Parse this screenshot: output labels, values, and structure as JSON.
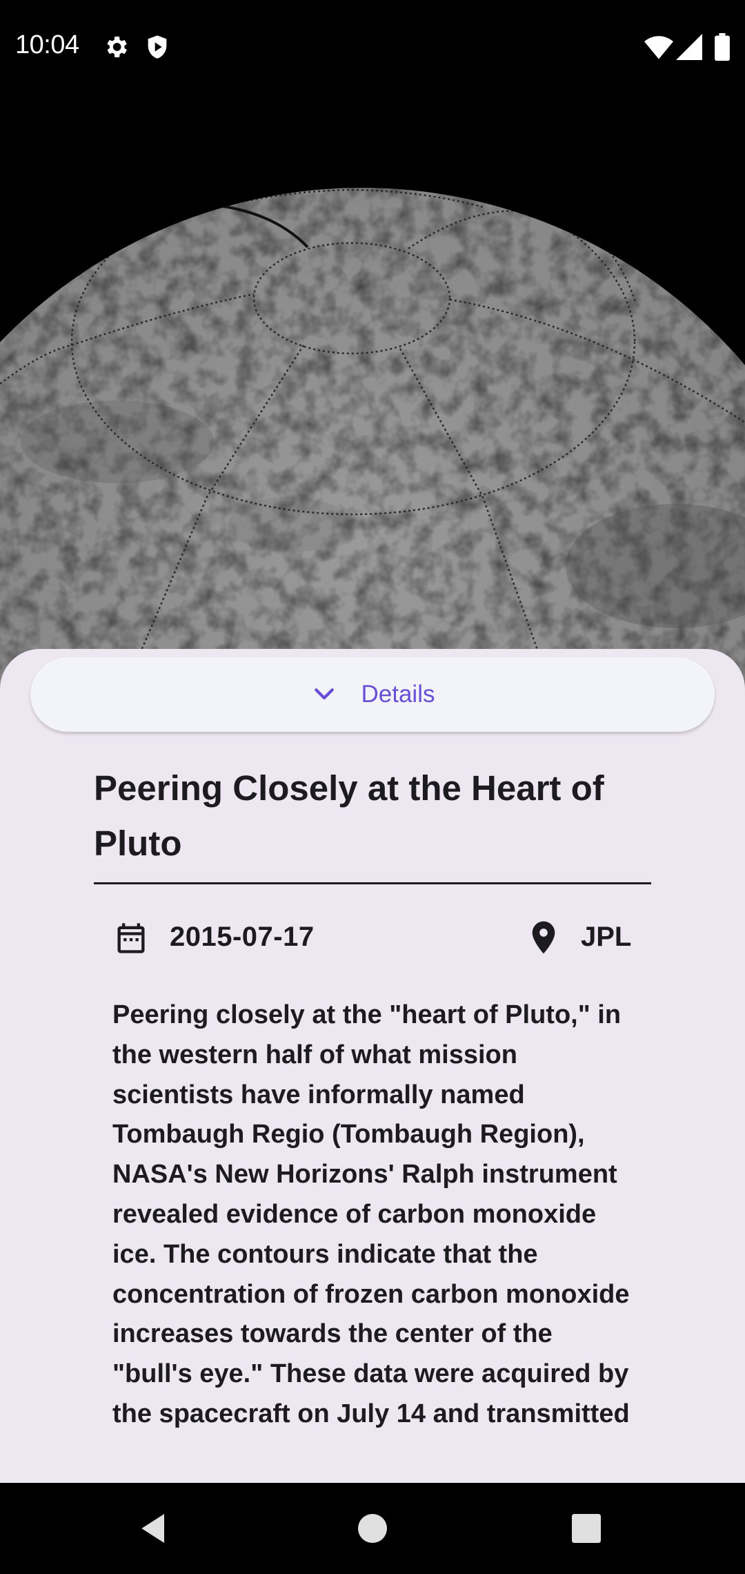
{
  "status_bar": {
    "time": "10:04",
    "icons": [
      "gear-icon",
      "shield-play-icon",
      "wifi-icon",
      "signal-icon",
      "battery-icon"
    ]
  },
  "hero": {
    "subject": "globe-image",
    "colors": {
      "surface": "#8c8c8c",
      "background": "#000000"
    }
  },
  "details_toggle": {
    "label": "Details",
    "icon": "chevron-down-icon",
    "color": "#6a4fd6"
  },
  "article": {
    "title": "Peering Closely at the Heart of Pluto",
    "date": "2015-07-17",
    "date_icon": "calendar-icon",
    "location": "JPL",
    "location_icon": "location-pin-icon",
    "description": "Peering closely at the \"heart of Pluto,\" in the western half of what mission scientists have informally named Tombaugh Regio (Tombaugh Region), NASA's New Horizons' Ralph instrument revealed evidence of carbon monoxide ice. The contours indicate that the concentration of frozen carbon monoxide increases towards the center of the \"bull's eye.\" These data were acquired by the spacecraft on July 14 and transmitted"
  },
  "nav_bar": {
    "buttons": [
      "back-icon",
      "home-icon",
      "recents-icon"
    ]
  },
  "colors": {
    "sheet_background": "#ede7f2",
    "pill_background": "#f3f4fa",
    "text": "#1c1b1f"
  }
}
